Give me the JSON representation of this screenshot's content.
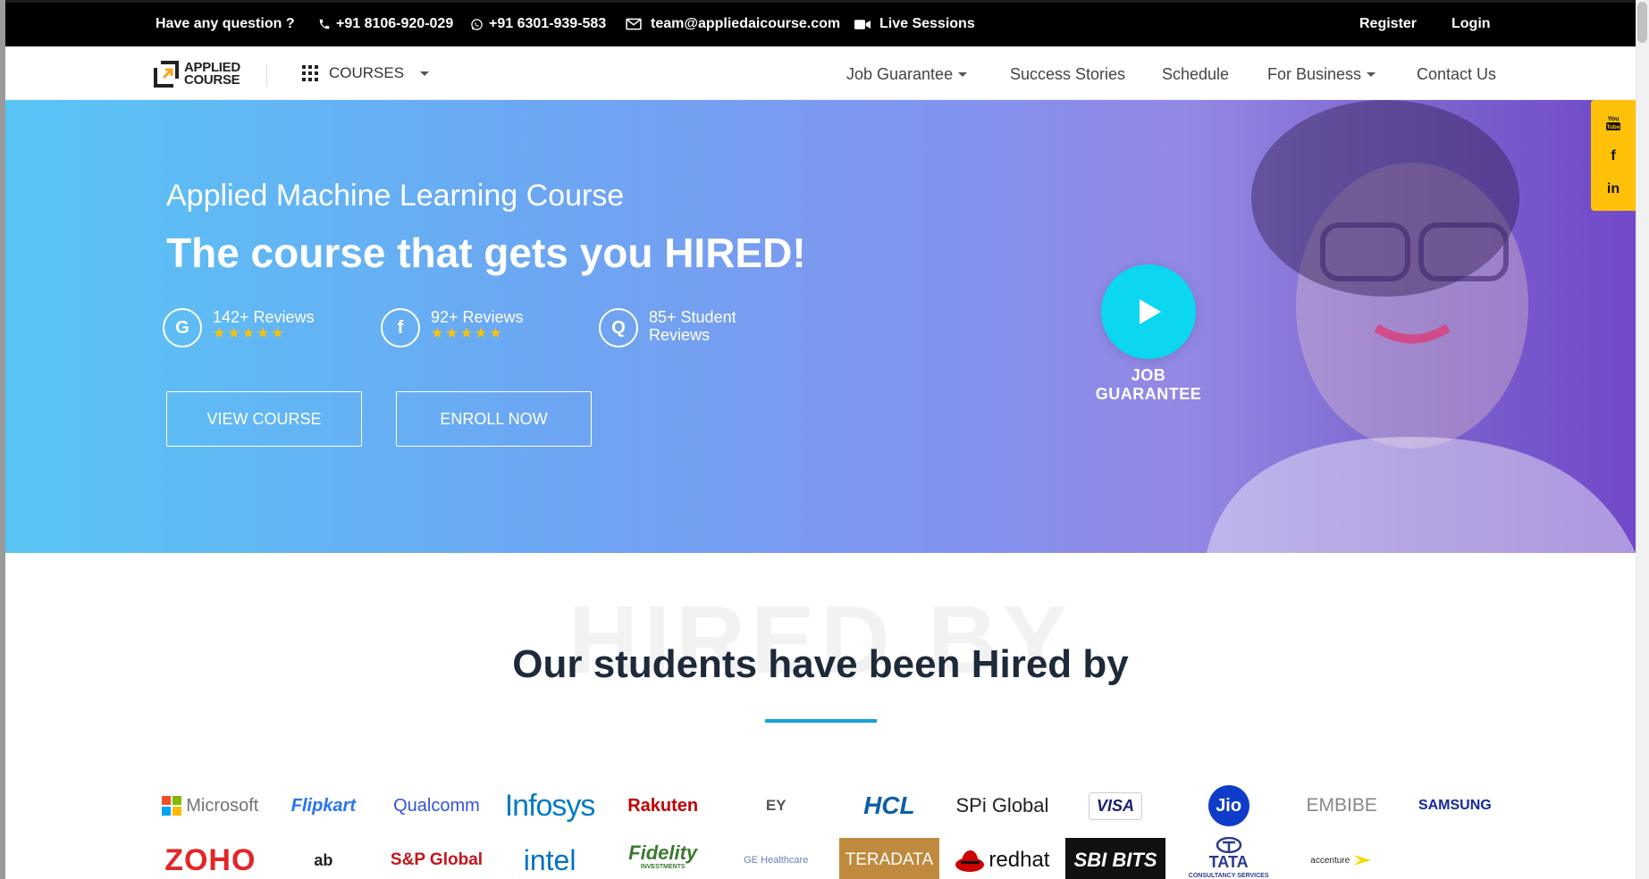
{
  "topbar": {
    "question": "Have any question ?",
    "phone": "+91 8106-920-029",
    "whatsapp": "+91 6301-939-583",
    "email": "team@appliedaicourse.com",
    "live": "Live Sessions",
    "register": "Register",
    "login": "Login"
  },
  "nav": {
    "logo_line1": "APPLIED",
    "logo_line2": "COURSE",
    "courses": "COURSES",
    "links": [
      "Job Guarantee",
      "Success Stories",
      "Schedule",
      "For Business",
      "Contact Us"
    ]
  },
  "hero": {
    "subtitle": "Applied Machine Learning Course",
    "title": "The course that gets you HIRED!",
    "reviews": [
      {
        "icon": "G",
        "line1": "142+ Reviews",
        "line2": "",
        "stars": "★★★★★"
      },
      {
        "icon": "f",
        "line1": "92+ Reviews",
        "line2": "",
        "stars": "★★★★★"
      },
      {
        "icon": "Q",
        "line1": "85+ Student",
        "line2": "Reviews",
        "stars": ""
      }
    ],
    "view_course": "VIEW COURSE",
    "enroll_now": "ENROLL NOW",
    "video_label": "JOB GUARANTEE"
  },
  "social": {
    "youtube": "You Tube",
    "facebook": "f",
    "linkedin": "in"
  },
  "hired": {
    "watermark": "HIRED BY",
    "title": "Our students have been Hired by",
    "row1": [
      "Microsoft",
      "Flipkart",
      "Qualcomm",
      "Infosys",
      "Rakuten",
      "EY",
      "HCL",
      "SPi Global",
      "VISA",
      "Jio",
      "EMBIBE",
      "SAMSUNG"
    ],
    "row2": [
      "ZOHO",
      "ab",
      "S&P Global",
      "intel",
      "Fidelity",
      "GE Healthcare",
      "TERADATA",
      "redhat",
      "SBI BITS",
      "TATA",
      "accenture"
    ],
    "row2_sub": {
      "fidelity": "INVESTMENTS",
      "tata": "CONSULTANCY SERVICES"
    }
  },
  "colors": {
    "accent": "#1aa0d8",
    "play": "#0cd6f0",
    "social": "#ffc107",
    "star": "#ffc107"
  }
}
